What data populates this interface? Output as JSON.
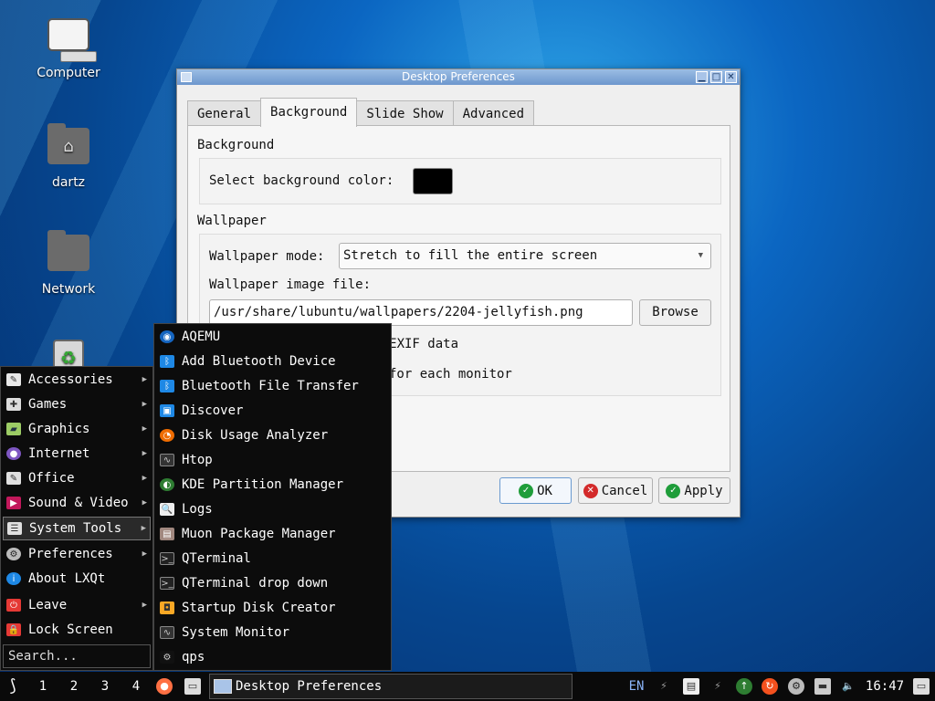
{
  "desktop": {
    "icons": [
      {
        "label": "Computer"
      },
      {
        "label": "dartz"
      },
      {
        "label": "Network"
      }
    ]
  },
  "dialog": {
    "title": "Desktop Preferences",
    "tabs": [
      "General",
      "Background",
      "Slide Show",
      "Advanced"
    ],
    "active_tab": "Background",
    "background_section": {
      "title": "Background",
      "color_label": "Select background color:",
      "color_value": "#000000"
    },
    "wallpaper_section": {
      "title": "Wallpaper",
      "mode_label": "Wallpaper mode:",
      "mode_value": "Stretch to fill the entire screen",
      "file_label": "Wallpaper image file:",
      "file_value": "/usr/share/lubuntu/wallpapers/2204-jellyfish.png",
      "browse_label": "Browse",
      "exif_label_visible": "d on EXIF data",
      "monitor_label_visible": "for each monitor"
    },
    "buttons": {
      "ok": "OK",
      "cancel": "Cancel",
      "apply": "Apply"
    }
  },
  "start_menu": {
    "items": [
      {
        "label": "Accessories",
        "icon": "accessories-icon",
        "arrow": true
      },
      {
        "label": "Games",
        "icon": "games-icon",
        "arrow": true
      },
      {
        "label": "Graphics",
        "icon": "graphics-icon",
        "arrow": true
      },
      {
        "label": "Internet",
        "icon": "internet-icon",
        "arrow": true
      },
      {
        "label": "Office",
        "icon": "office-icon",
        "arrow": true
      },
      {
        "label": "Sound & Video",
        "icon": "sound-video-icon",
        "arrow": true
      },
      {
        "label": "System Tools",
        "icon": "system-tools-icon",
        "arrow": true
      },
      {
        "label": "Preferences",
        "icon": "preferences-icon",
        "arrow": true
      },
      {
        "label": "About LXQt",
        "icon": "info-icon",
        "arrow": false
      },
      {
        "label": "Leave",
        "icon": "power-icon",
        "arrow": true
      },
      {
        "label": "Lock Screen",
        "icon": "lock-icon",
        "arrow": false
      }
    ],
    "search_placeholder": "Search..."
  },
  "system_tools_submenu": {
    "items": [
      {
        "label": "AQEMU",
        "icon": "aqemu-icon"
      },
      {
        "label": "Add Bluetooth Device",
        "icon": "bluetooth-icon"
      },
      {
        "label": "Bluetooth File Transfer",
        "icon": "bluetooth-icon"
      },
      {
        "label": "Discover",
        "icon": "discover-icon"
      },
      {
        "label": "Disk Usage Analyzer",
        "icon": "disk-usage-icon"
      },
      {
        "label": "Htop",
        "icon": "htop-icon"
      },
      {
        "label": "KDE Partition Manager",
        "icon": "partition-icon"
      },
      {
        "label": "Logs",
        "icon": "logs-icon"
      },
      {
        "label": "Muon Package Manager",
        "icon": "package-icon"
      },
      {
        "label": "QTerminal",
        "icon": "terminal-icon"
      },
      {
        "label": "QTerminal drop down",
        "icon": "terminal-icon"
      },
      {
        "label": "Startup Disk Creator",
        "icon": "startup-disk-icon"
      },
      {
        "label": "System Monitor",
        "icon": "system-monitor-icon"
      },
      {
        "label": "qps",
        "icon": "qps-icon"
      }
    ]
  },
  "taskbar": {
    "workspaces": [
      "1",
      "2",
      "3",
      "4"
    ],
    "task_label": "Desktop Preferences",
    "keyboard_layout": "EN",
    "clock": "16:47"
  }
}
